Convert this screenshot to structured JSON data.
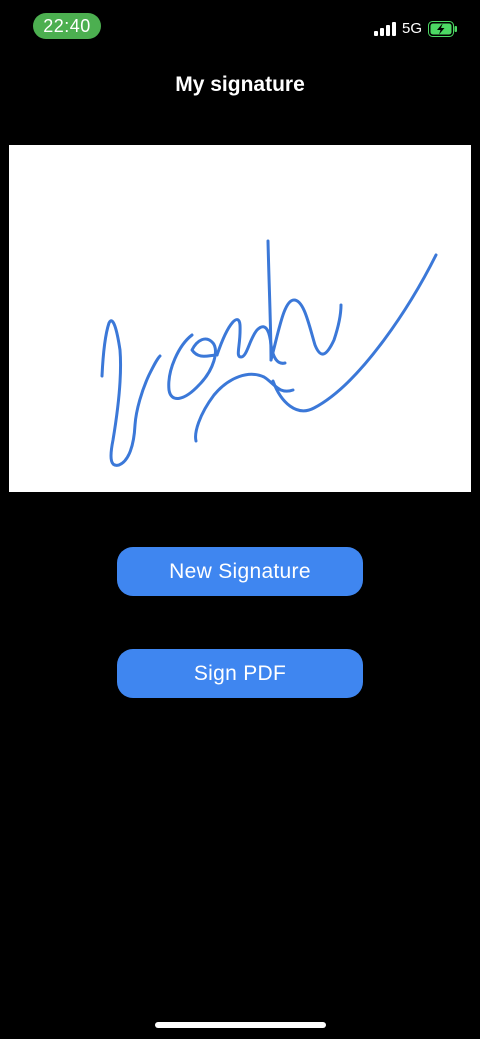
{
  "status_bar": {
    "time": "22:40",
    "network": "5G",
    "icons": [
      "signal-icon",
      "battery-charging-icon"
    ],
    "time_pill_color": "#4caf50",
    "battery_color": "#4cd964"
  },
  "header": {
    "title": "My signature"
  },
  "signature": {
    "stroke_color": "#3b78d8",
    "background_color": "#ffffff"
  },
  "actions": {
    "new_signature_label": "New Signature",
    "sign_pdf_label": "Sign PDF",
    "button_color": "#3f86f0"
  }
}
